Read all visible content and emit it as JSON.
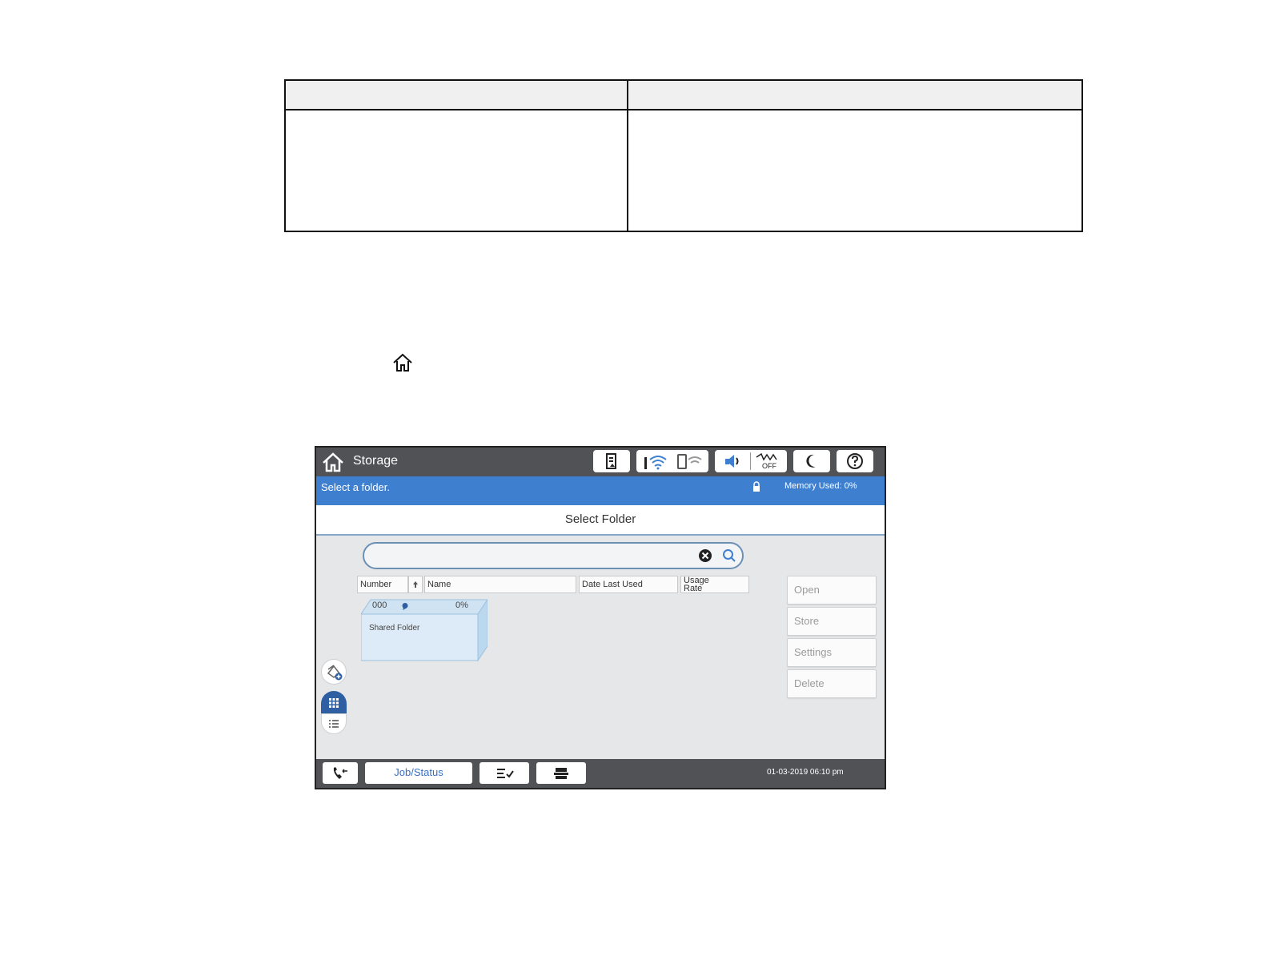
{
  "screen": {
    "title": "Storage",
    "status_message": "Select a folder.",
    "memory_used": "Memory Used: 0%",
    "header_title": "Select Folder",
    "search": {
      "value": "",
      "placeholder": ""
    },
    "columns": {
      "number": "Number",
      "name": "Name",
      "date_last_used": "Date Last Used",
      "usage_rate_line1": "Usage",
      "usage_rate_line2": "Rate"
    },
    "folder": {
      "number": "000",
      "usage": "0%",
      "name": "Shared Folder"
    },
    "buttons": {
      "open": "Open",
      "store": "Store",
      "settings": "Settings",
      "delete": "Delete"
    },
    "bottom": {
      "job_status": "Job/Status",
      "datetime": "01-03-2019 06:10 pm"
    },
    "toolbar_icons": [
      "ink-status-icon",
      "wifi-icon",
      "wifi-direct-icon",
      "sound-icon",
      "fax-off-icon",
      "sleep-icon",
      "help-icon"
    ],
    "colors": {
      "titlebar": "#505256",
      "statusbar": "#3e7fd0",
      "background": "#e6e7e9",
      "accent": "#2f5fa3"
    }
  }
}
